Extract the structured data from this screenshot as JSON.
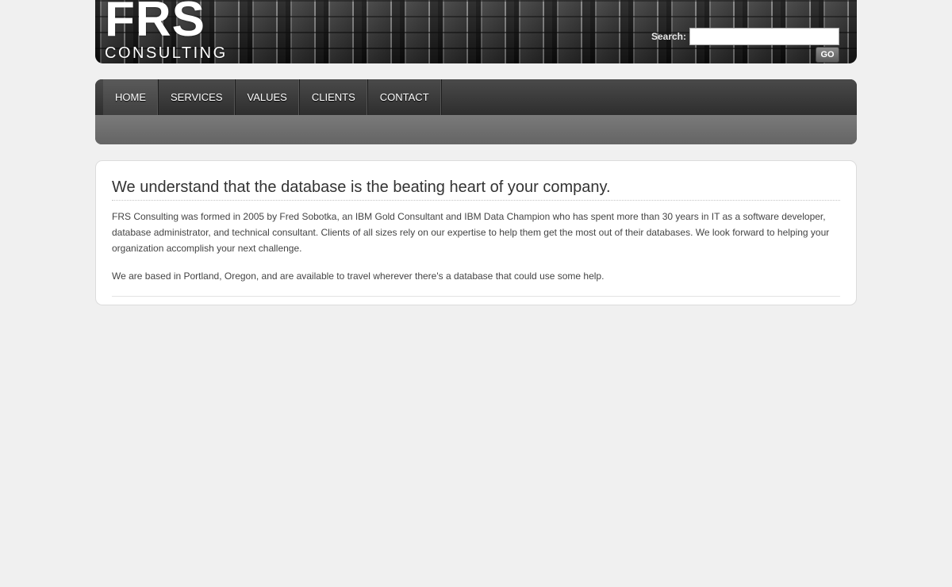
{
  "header": {
    "logo_main": "FRS",
    "logo_sub": "CONSULTING",
    "search_label": "Search:",
    "search_value": "",
    "go_label": "GO"
  },
  "nav": {
    "items": [
      {
        "label": "HOME",
        "active": true
      },
      {
        "label": "SERVICES",
        "active": false
      },
      {
        "label": "VALUES",
        "active": false
      },
      {
        "label": "CLIENTS",
        "active": false
      },
      {
        "label": "CONTACT",
        "active": false
      }
    ]
  },
  "main": {
    "heading": "We understand that the database is the beating heart of your company.",
    "paragraphs": [
      "FRS Consulting was formed in 2005 by Fred Sobotka, an IBM Gold Consultant and IBM Data Champion who has spent more than 30 years in IT as a software developer, database administrator, and technical consultant. Clients of all sizes rely on our expertise to help them get the most out of their databases. We look forward to helping your organization accomplish your next challenge.",
      "We are based in Portland, Oregon, and are available to travel wherever there's a database that could use some help."
    ]
  }
}
